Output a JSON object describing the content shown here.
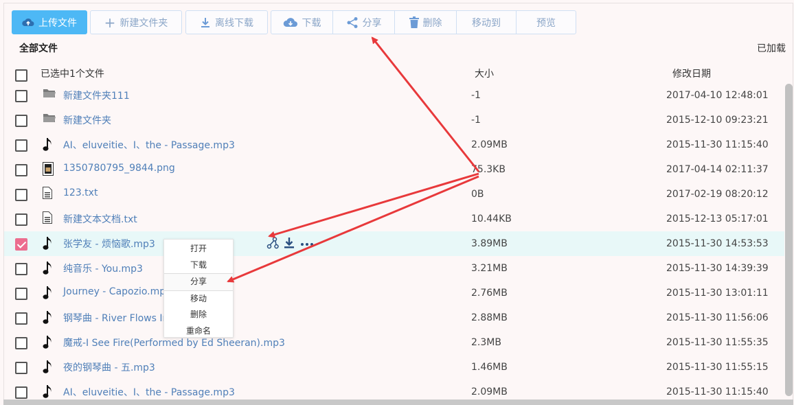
{
  "toolbar": {
    "upload_label": "上传文件",
    "new_folder_label": "新建文件夹",
    "offline_download_label": "离线下载",
    "download_label": "下载",
    "share_label": "分享",
    "delete_label": "删除",
    "move_label": "移动到",
    "preview_label": "预览"
  },
  "breadcrumb": "全部文件",
  "loaded_status": "已加载",
  "table": {
    "select_info": "已选中1个文件",
    "col_size": "大小",
    "col_date": "修改日期",
    "rows": [
      {
        "name": "新建文件夹111",
        "size": "-1",
        "date": "2017-04-10 12:48:01",
        "icon": "folder-icon",
        "checked": false
      },
      {
        "name": "新建文件夹",
        "size": "-1",
        "date": "2015-12-10 09:23:21",
        "icon": "folder-icon",
        "checked": false
      },
      {
        "name": "AI、eluveitie、I、the - Passage.mp3",
        "size": "2.09MB",
        "date": "2015-11-30 11:15:40",
        "icon": "music-note-icon",
        "checked": false
      },
      {
        "name": "1350780795_9844.png",
        "size": "75.3KB",
        "date": "2017-04-14 02:11:37",
        "icon": "image-file-icon",
        "checked": false
      },
      {
        "name": "123.txt",
        "size": "0B",
        "date": "2017-02-19 08:20:12",
        "icon": "text-file-icon",
        "checked": false
      },
      {
        "name": "新建文本文档.txt",
        "size": "10.44KB",
        "date": "2015-12-13 05:17:01",
        "icon": "text-file-icon",
        "checked": false
      },
      {
        "name": "张学友 - 烦恼歌.mp3",
        "size": "3.89MB",
        "date": "2015-11-30 14:53:53",
        "icon": "music-note-icon",
        "checked": true
      },
      {
        "name": "纯音乐 - You.mp3",
        "size": "3.21MB",
        "date": "2015-11-30 14:39:39",
        "icon": "music-note-icon",
        "checked": false
      },
      {
        "name": "Journey - Capozio.mp",
        "size": "2.76MB",
        "date": "2015-11-30 13:01:11",
        "icon": "music-note-icon",
        "checked": false
      },
      {
        "name": "钢琴曲 - River Flows In",
        "size": "2.88MB",
        "date": "2015-11-30 11:56:06",
        "icon": "music-note-icon",
        "checked": false
      },
      {
        "name": "魔戒-I See Fire(Performed by Ed Sheeran).mp3",
        "size": "2.3MB",
        "date": "2015-11-30 11:55:35",
        "icon": "music-note-icon",
        "checked": false
      },
      {
        "name": "夜的钢琴曲 - 五.mp3",
        "size": "1.46MB",
        "date": "2015-11-30 11:55:15",
        "icon": "music-note-icon",
        "checked": false
      },
      {
        "name": "AI、eluveitie、I、the - Passage.mp3",
        "size": "2.09MB",
        "date": "2015-11-30 11:15:40",
        "icon": "music-note-icon",
        "checked": false
      }
    ]
  },
  "context_menu": {
    "items": [
      "打开",
      "下载",
      "分享",
      "移动",
      "删除",
      "重命名"
    ],
    "active_item": "分享"
  },
  "colors": {
    "primary_button": "#4db8f5",
    "link_text": "#4f7fb8",
    "selected_row": "#e8f8f8",
    "checkbox_checked": "#ec6d8f",
    "annotation_arrow": "#e8393b"
  }
}
